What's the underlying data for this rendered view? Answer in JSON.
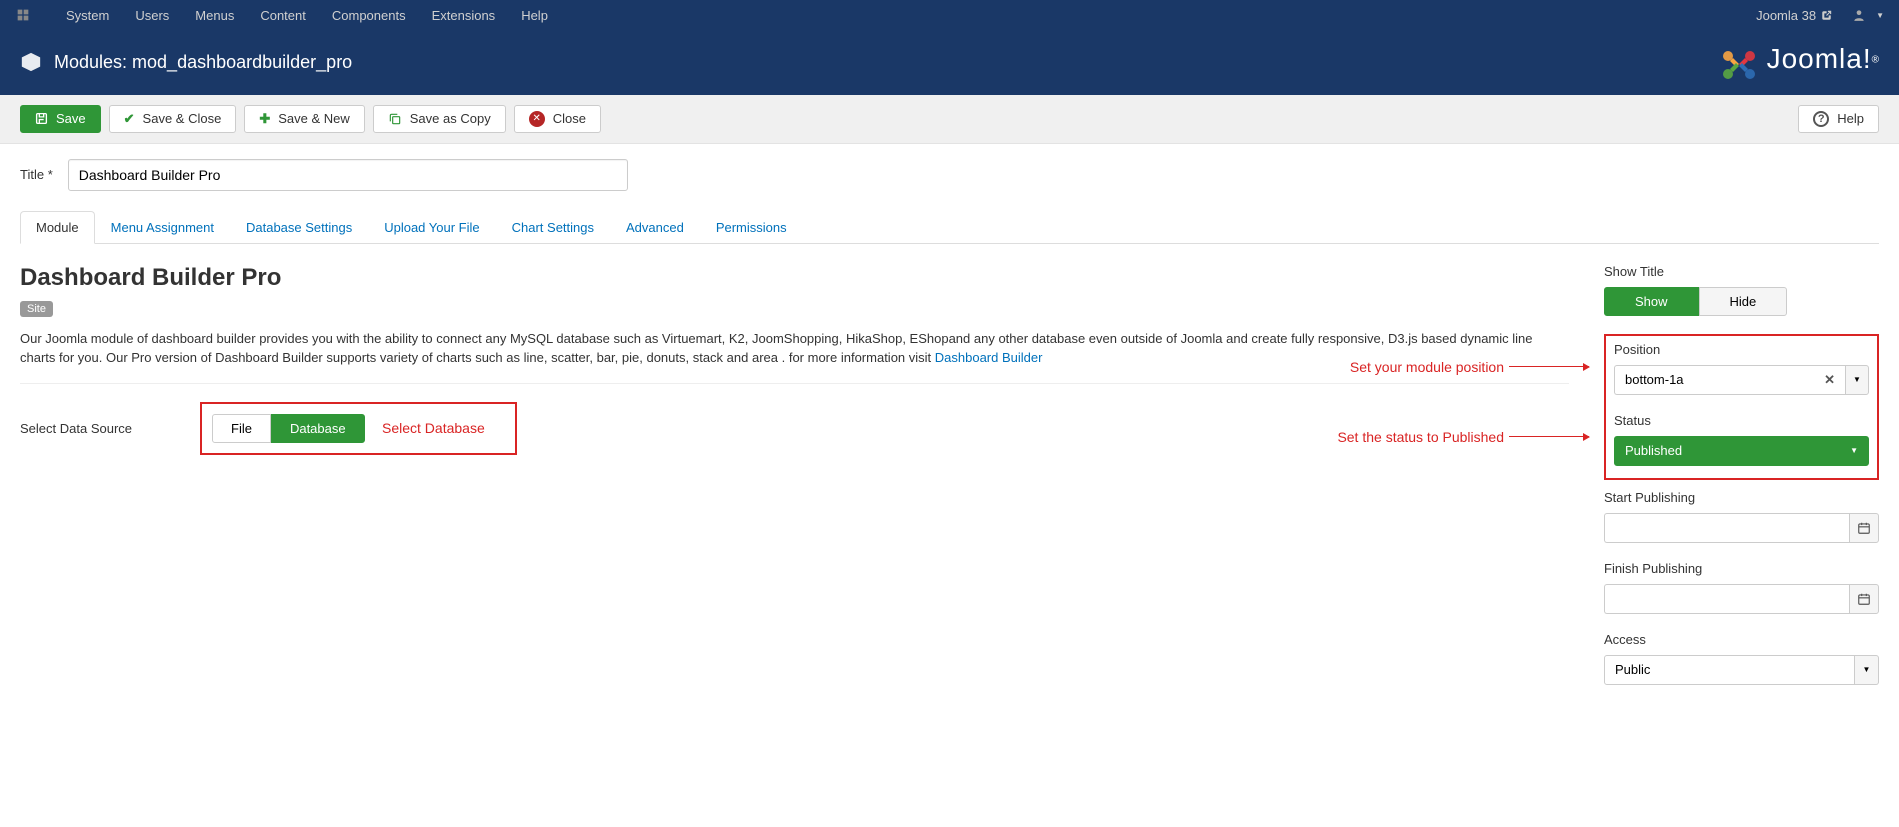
{
  "topbar": {
    "menu": [
      "System",
      "Users",
      "Menus",
      "Content",
      "Components",
      "Extensions",
      "Help"
    ],
    "site_name": "Joomla 38"
  },
  "header": {
    "title": "Modules: mod_dashboardbuilder_pro",
    "logo_text": "Joomla!",
    "logo_sup": "®"
  },
  "toolbar": {
    "save": "Save",
    "save_close": "Save & Close",
    "save_new": "Save & New",
    "save_copy": "Save as Copy",
    "close": "Close",
    "help": "Help"
  },
  "form": {
    "title_label": "Title *",
    "title_value": "Dashboard Builder Pro"
  },
  "tabs": [
    "Module",
    "Menu Assignment",
    "Database Settings",
    "Upload Your File",
    "Chart Settings",
    "Advanced",
    "Permissions"
  ],
  "module": {
    "heading": "Dashboard Builder Pro",
    "badge": "Site",
    "description": "Our Joomla module of dashboard builder provides you with the ability to connect any MySQL database such as Virtuemart, K2, JoomShopping, HikaShop, EShopand any other database even outside of Joomla and create fully responsive, D3.js based dynamic line charts for you. Our Pro version of Dashboard Builder supports variety of charts such as line, scatter, bar, pie, donuts, stack and area . for more information visit ",
    "description_link": "Dashboard Builder",
    "select_source_label": "Select Data Source",
    "source_options": [
      "File",
      "Database"
    ],
    "annotation_select_db": "Select Database"
  },
  "sidebar": {
    "show_title_label": "Show Title",
    "show_title_options": [
      "Show",
      "Hide"
    ],
    "position_label": "Position",
    "position_value": "bottom-1a",
    "status_label": "Status",
    "status_value": "Published",
    "start_publishing_label": "Start Publishing",
    "finish_publishing_label": "Finish Publishing",
    "access_label": "Access",
    "access_value": "Public"
  },
  "annotations": {
    "position": "Set your module position",
    "status": "Set the status to Published"
  }
}
